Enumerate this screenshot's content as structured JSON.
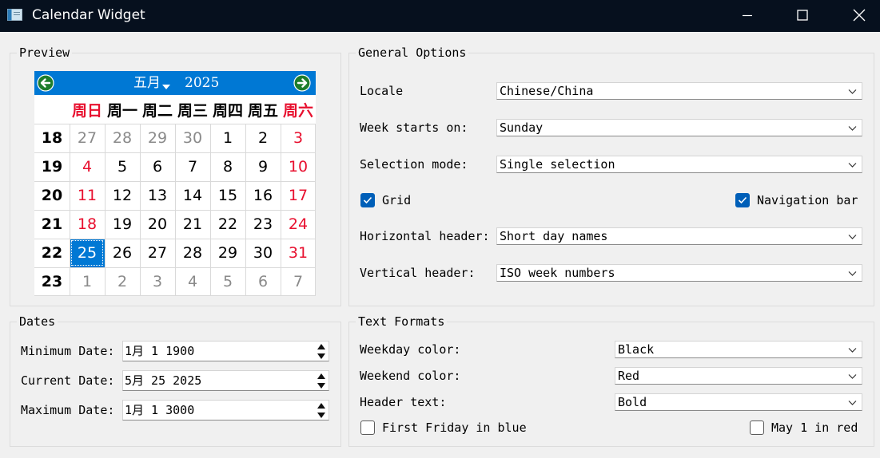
{
  "window": {
    "title": "Calendar Widget",
    "icon": "app-window-icon",
    "controls": [
      "minimize-icon",
      "maximize-icon",
      "close-icon"
    ]
  },
  "preview": {
    "title": "Preview",
    "calendar": {
      "month": "五月",
      "year": "2025",
      "prev_icon": "arrow-left-icon",
      "next_icon": "arrow-right-icon",
      "accent": "#0078d4",
      "weekend_color": "#e8102f",
      "day_headers": [
        "周日",
        "周一",
        "周二",
        "周三",
        "周四",
        "周五",
        "周六"
      ],
      "weeks": [
        {
          "num": "18",
          "days": [
            {
              "d": "27",
              "type": "other"
            },
            {
              "d": "28",
              "type": "other"
            },
            {
              "d": "29",
              "type": "other"
            },
            {
              "d": "30",
              "type": "other"
            },
            {
              "d": "1",
              "type": "normal"
            },
            {
              "d": "2",
              "type": "normal"
            },
            {
              "d": "3",
              "type": "weekend"
            }
          ]
        },
        {
          "num": "19",
          "days": [
            {
              "d": "4",
              "type": "weekend"
            },
            {
              "d": "5",
              "type": "normal"
            },
            {
              "d": "6",
              "type": "normal"
            },
            {
              "d": "7",
              "type": "normal"
            },
            {
              "d": "8",
              "type": "normal"
            },
            {
              "d": "9",
              "type": "normal"
            },
            {
              "d": "10",
              "type": "weekend"
            }
          ]
        },
        {
          "num": "20",
          "days": [
            {
              "d": "11",
              "type": "weekend"
            },
            {
              "d": "12",
              "type": "normal"
            },
            {
              "d": "13",
              "type": "normal"
            },
            {
              "d": "14",
              "type": "normal"
            },
            {
              "d": "15",
              "type": "normal"
            },
            {
              "d": "16",
              "type": "normal"
            },
            {
              "d": "17",
              "type": "weekend"
            }
          ]
        },
        {
          "num": "21",
          "days": [
            {
              "d": "18",
              "type": "weekend"
            },
            {
              "d": "19",
              "type": "normal"
            },
            {
              "d": "20",
              "type": "normal"
            },
            {
              "d": "21",
              "type": "normal"
            },
            {
              "d": "22",
              "type": "normal"
            },
            {
              "d": "23",
              "type": "normal"
            },
            {
              "d": "24",
              "type": "weekend"
            }
          ]
        },
        {
          "num": "22",
          "days": [
            {
              "d": "25",
              "type": "selected"
            },
            {
              "d": "26",
              "type": "normal"
            },
            {
              "d": "27",
              "type": "normal"
            },
            {
              "d": "28",
              "type": "normal"
            },
            {
              "d": "29",
              "type": "normal"
            },
            {
              "d": "30",
              "type": "normal"
            },
            {
              "d": "31",
              "type": "weekend"
            }
          ]
        },
        {
          "num": "23",
          "days": [
            {
              "d": "1",
              "type": "other"
            },
            {
              "d": "2",
              "type": "other"
            },
            {
              "d": "3",
              "type": "other"
            },
            {
              "d": "4",
              "type": "other"
            },
            {
              "d": "5",
              "type": "other"
            },
            {
              "d": "6",
              "type": "other"
            },
            {
              "d": "7",
              "type": "other"
            }
          ]
        }
      ]
    }
  },
  "general": {
    "title": "General Options",
    "locale_label": "Locale",
    "locale_value": "Chinese/China",
    "week_start_label": "Week starts on:",
    "week_start_value": "Sunday",
    "selection_label": "Selection mode:",
    "selection_value": "Single selection",
    "grid_label": "Grid",
    "grid_checked": true,
    "navbar_label": "Navigation bar",
    "navbar_checked": true,
    "hheader_label": "Horizontal header:",
    "hheader_value": "Short day names",
    "vheader_label": "Vertical header:",
    "vheader_value": "ISO week numbers"
  },
  "dates": {
    "title": "Dates",
    "min_label": "Minimum Date:",
    "min_value": "1月 1 1900",
    "current_label": "Current Date:",
    "current_value": "5月 25 2025",
    "max_label": "Maximum Date:",
    "max_value": "1月 1 3000"
  },
  "formats": {
    "title": "Text Formats",
    "weekday_label": "Weekday color:",
    "weekday_value": "Black",
    "weekend_label": "Weekend color:",
    "weekend_value": "Red",
    "header_label": "Header text:",
    "header_value": "Bold",
    "friday_label": "First Friday in blue",
    "friday_checked": false,
    "may_label": "May 1 in red",
    "may_checked": false
  }
}
